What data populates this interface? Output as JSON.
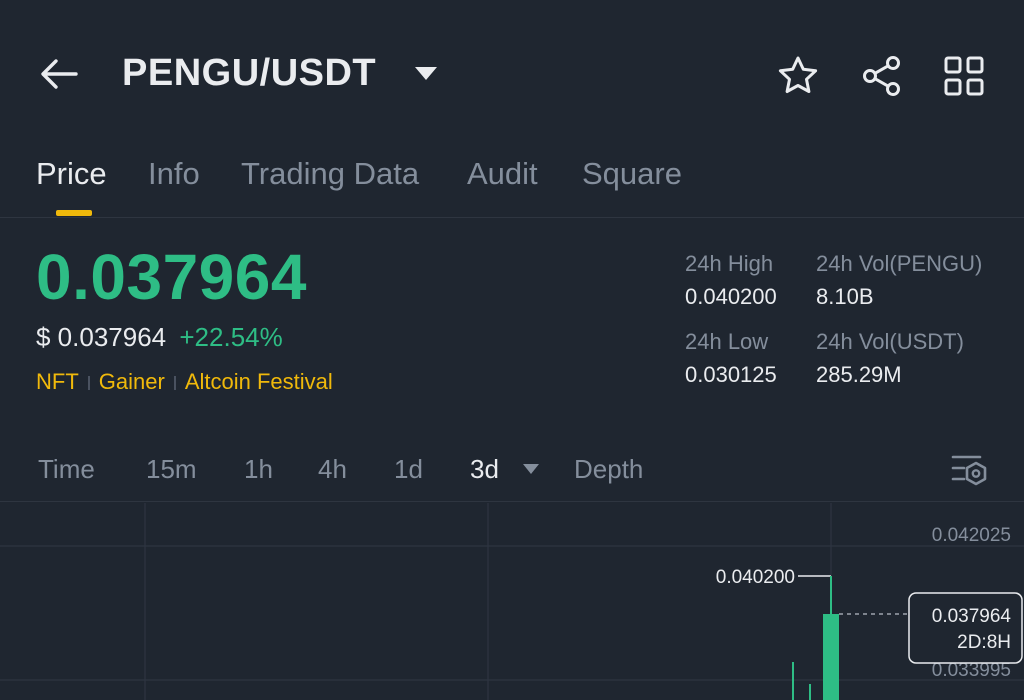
{
  "header": {
    "back_icon": "arrow-left-icon",
    "title": "PENGU/USDT",
    "caret_icon": "caret-down-icon",
    "actions": [
      "star-icon",
      "share-icon",
      "grid-icon"
    ]
  },
  "tabs": [
    {
      "label": "Price",
      "active": true
    },
    {
      "label": "Info",
      "active": false
    },
    {
      "label": "Trading Data",
      "active": false
    },
    {
      "label": "Audit",
      "active": false
    },
    {
      "label": "Square",
      "active": false
    }
  ],
  "ticker": {
    "price": "0.037964",
    "fiat_price": "$ 0.037964",
    "change": "+22.54%",
    "tags": [
      "NFT",
      "Gainer",
      "Altcoin Festival"
    ]
  },
  "stats": {
    "high_label": "24h High",
    "high_value": "0.040200",
    "low_label": "24h Low",
    "low_value": "0.030125",
    "vol_base_label": "24h Vol(PENGU)",
    "vol_base_value": "8.10B",
    "vol_quote_label": "24h Vol(USDT)",
    "vol_quote_value": "285.29M"
  },
  "intervals": {
    "items": [
      "Time",
      "15m",
      "1h",
      "4h",
      "1d",
      "3d",
      "Depth"
    ],
    "active": "3d",
    "settings_icon": "chart-settings-icon"
  },
  "colors": {
    "up": "#2ebd85",
    "accent": "#f0b90b",
    "background": "#1f2630",
    "muted": "#848e9c"
  },
  "chart": {
    "y_ticks": [
      "0.042025",
      "0.033995"
    ],
    "high_marker": "0.040200",
    "last_price": "0.037964",
    "countdown": "2D:8H"
  },
  "chart_data": {
    "type": "candlestick",
    "y_axis": {
      "ticks": [
        0.042025,
        0.033995
      ]
    },
    "high_marker": 0.0402,
    "last_price": 0.037964,
    "countdown": "2D:8H",
    "last_candle": {
      "high": 0.0402,
      "close": 0.037964,
      "direction": "up"
    }
  }
}
